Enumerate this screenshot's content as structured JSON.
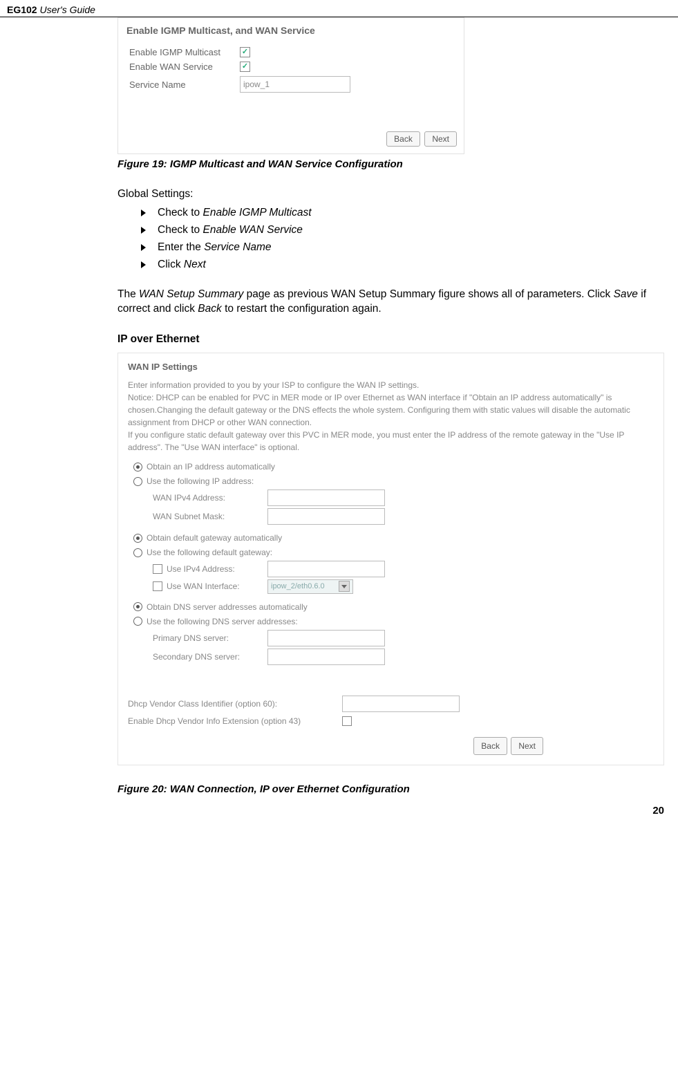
{
  "header": {
    "product": "EG102",
    "doc": "User's Guide"
  },
  "panel1": {
    "title": "Enable IGMP Multicast, and WAN Service",
    "row_igmp": "Enable IGMP Multicast",
    "row_wan": "Enable WAN Service",
    "row_svc": "Service Name",
    "svc_value": "ipow_1",
    "back": "Back",
    "next": "Next"
  },
  "fig19": "Figure 19: IGMP Multicast and WAN Service Configuration",
  "global_heading": "Global Settings:",
  "bullets": {
    "b1_a": "Check to ",
    "b1_b": "Enable IGMP Multicast",
    "b2_a": "Check to ",
    "b2_b": "Enable WAN Service",
    "b3_a": "Enter the ",
    "b3_b": "Service Name",
    "b4_a": "Click ",
    "b4_b": "Next"
  },
  "para": {
    "p1_a": "The ",
    "p1_b": "WAN Setup Summary",
    "p1_c": " page as previous WAN Setup Summary figure shows all of parameters. Click ",
    "p1_d": "Save",
    "p1_e": " if correct and click ",
    "p1_f": "Back",
    "p1_g": " to restart the configuration again."
  },
  "sec_title": "IP over Ethernet",
  "wan": {
    "heading": "WAN IP Settings",
    "intro1": "Enter information provided to you by your ISP to configure the WAN IP settings.",
    "intro2": "Notice: DHCP can be enabled for PVC in MER mode or IP over Ethernet as WAN interface if \"Obtain an IP address automatically\" is chosen.Changing the default gateway or the DNS effects the whole system. Configuring them with static values will disable the automatic assignment from DHCP or other WAN connection.",
    "intro3": "If you configure static default gateway over this PVC in MER mode, you must enter the IP address of the remote gateway in the \"Use IP address\". The \"Use WAN interface\" is optional.",
    "opt_auto_ip": "Obtain an IP address automatically",
    "opt_static_ip": "Use the following IP address:",
    "lbl_wan_ipv4": "WAN IPv4 Address:",
    "lbl_wan_mask": "WAN Subnet Mask:",
    "opt_auto_gw": "Obtain default gateway automatically",
    "opt_static_gw": "Use the following default gateway:",
    "chk_use_ipv4": "Use IPv4 Address:",
    "chk_use_wanif": "Use WAN Interface:",
    "wanif_value": "ipow_2/eth0.6.0",
    "opt_auto_dns": "Obtain DNS server addresses automatically",
    "opt_static_dns": "Use the following DNS server addresses:",
    "lbl_dns1": "Primary DNS server:",
    "lbl_dns2": "Secondary DNS server:",
    "vendor60": "Dhcp Vendor Class Identifier (option 60):",
    "vendor43": "Enable Dhcp Vendor Info Extension (option 43)",
    "back": "Back",
    "next": "Next"
  },
  "fig20": "Figure 20: WAN Connection, IP over Ethernet Configuration",
  "page": "20"
}
